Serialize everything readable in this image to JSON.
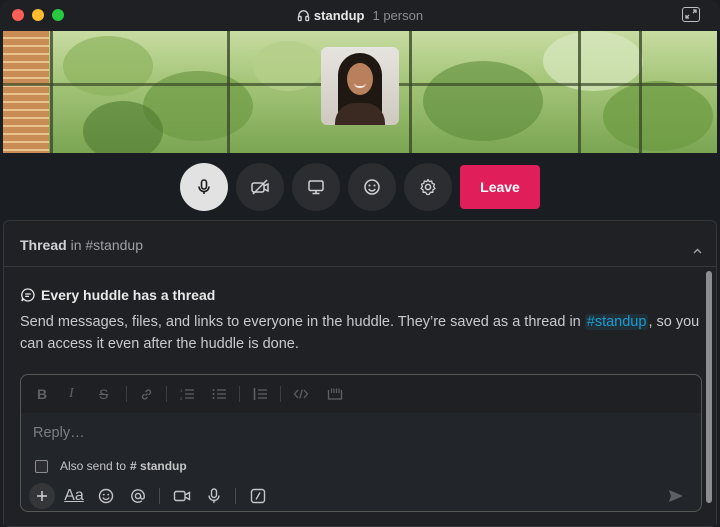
{
  "window": {
    "title": "standup",
    "participants": "1 person"
  },
  "controls": {
    "leave_label": "Leave"
  },
  "thread": {
    "label": "Thread",
    "in_word": "in",
    "channel": "#standup"
  },
  "info": {
    "heading": "Every huddle has a thread",
    "text_before": "Send messages, files, and links to everyone in the huddle. They’re saved as a thread in ",
    "channel_link": "#standup",
    "text_after": ", so you can access it even after the huddle is done."
  },
  "composer": {
    "placeholder": "Reply…",
    "also_send_label": "Also send to",
    "also_send_channel": "# standup",
    "also_send_checked": false,
    "format_text_label": "Aa"
  },
  "colors": {
    "leave": "#e01e5a",
    "link": "#1d9bd1",
    "mic_active": "#e2e2e2"
  }
}
